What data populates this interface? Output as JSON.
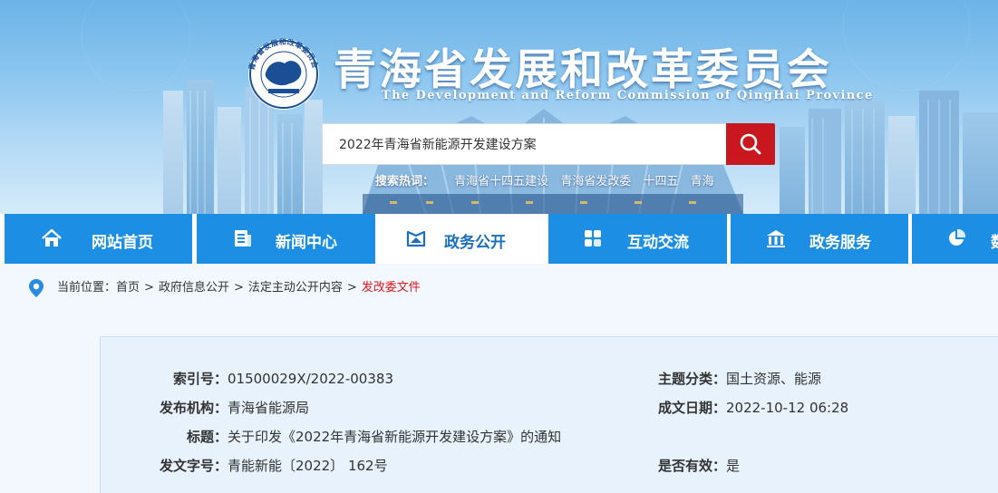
{
  "header": {
    "title": "青海省发展和改革委员会",
    "subtitle": "The Development and Reform Commission of QingHai Province",
    "seal_text": "青海省发展和改革委员会"
  },
  "search": {
    "value": "2022年青海省新能源开发建设方案",
    "button_icon": "search-icon"
  },
  "hot_search": {
    "label": "搜索热词：",
    "terms": [
      "青海省十四五建设",
      "青海省发改委",
      "十四五",
      "青海"
    ]
  },
  "nav": {
    "items": [
      {
        "label": "网站首页",
        "icon": "home-icon"
      },
      {
        "label": "新闻中心",
        "icon": "news-icon"
      },
      {
        "label": "政务公开",
        "icon": "open-affairs-icon",
        "active": true
      },
      {
        "label": "互动交流",
        "icon": "interaction-icon"
      },
      {
        "label": "政务服务",
        "icon": "service-building-icon"
      },
      {
        "label": "数",
        "icon": "pie-chart-icon"
      }
    ]
  },
  "breadcrumb": {
    "prefix": "当前位置：",
    "items": [
      "首页",
      "政府信息公开",
      "法定主动公开内容"
    ],
    "current": "发改委文件",
    "separator": ">"
  },
  "meta": {
    "index_no": {
      "key": "索引号：",
      "value": "01500029X/2022-00383"
    },
    "topic": {
      "key": "主题分类：",
      "value": "国土资源、能源"
    },
    "publisher": {
      "key": "发布机构：",
      "value": "青海省能源局"
    },
    "date": {
      "key": "成文日期：",
      "value": "2022-10-12 06:28"
    },
    "title": {
      "key": "标题：",
      "value": "关于印发《2022年青海省新能源开发建设方案》的通知"
    },
    "doc_no": {
      "key": "发文字号：",
      "value": "青能新能〔2022〕 162号"
    },
    "valid": {
      "key": "是否有效：",
      "value": "是"
    }
  },
  "colors": {
    "nav_blue": "#1c8fe5",
    "search_red": "#c8171e",
    "current_crumb_red": "#e0161e",
    "panel_bg": "#e7f2fc"
  }
}
